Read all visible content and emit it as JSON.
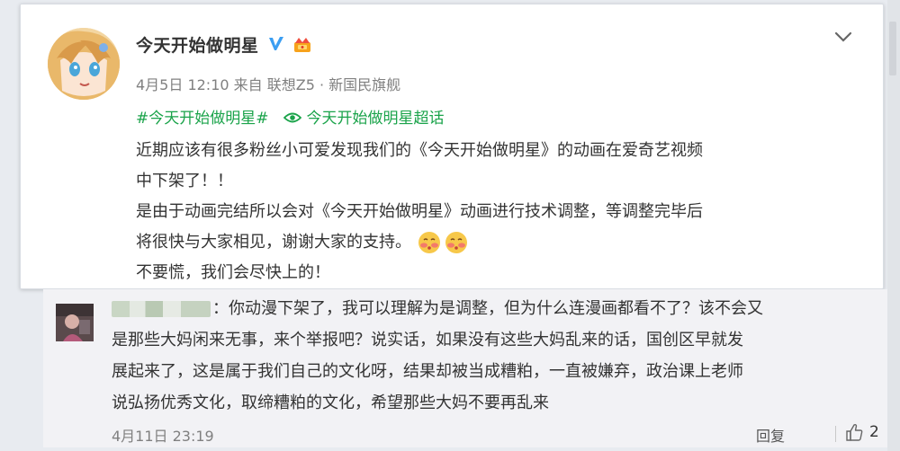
{
  "post": {
    "author": "今天开始做明星",
    "date": "4月5日 12:10",
    "source_prefix": "来自",
    "source_device": "联想Z5 · 新国民旗舰",
    "hashtag": "#今天开始做明星#",
    "supertopic": "今天开始做明星超话",
    "body_lines": [
      "近期应该有很多粉丝小可爱发现我们的《今天开始做明星》的动画在爱奇艺视频",
      "中下架了！！",
      "是由于动画完结所以会对《今天开始做明星》动画进行技术调整，等调整完毕后",
      "将很快与大家相见，谢谢大家的支持。",
      "不要慌，我们会尽快上的！"
    ]
  },
  "comment": {
    "text_lines": [
      "：你动漫下架了，我可以理解为是调整，但为什么连漫画都看不了？该不会又",
      "是那些大妈闲来无事，来个举报吧？说实话，如果没有这些大妈乱来的话，国创区早就发",
      "展起来了，这是属于我们自己的文化呀，结果却被当成糟粕，一直被嫌弃，政治课上老师",
      "说弘扬优秀文化，取缔糟粕的文化，希望那些大妈不要再乱来"
    ],
    "time": "4月11日 23:19",
    "reply_label": "回复",
    "like_count": "2"
  },
  "icons": {
    "verified": "verified-v-icon",
    "vip": "vip-crown-icon",
    "more": "chevron-down-icon",
    "supertopic": "supertopic-eye-icon",
    "emoji": "blush-emoji-icon",
    "like": "thumbs-up-icon"
  },
  "colors": {
    "link_green": "#1aa34a",
    "verified_blue": "#3b9ef2",
    "meta_gray": "#808080"
  }
}
